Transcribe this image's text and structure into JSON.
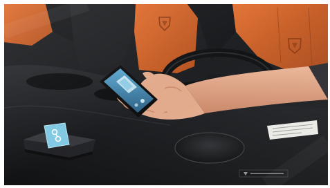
{
  "image": {
    "kind": "photograph",
    "subject_icons": {
      "device_logo": "bluetooth-key-icon",
      "seat_emblem": "shield-emblem-icon"
    },
    "colors": {
      "seat_orange": "#d9652a",
      "seat_black": "#1c1d20",
      "dashboard": "#121315",
      "device_accent": "#7ec8e3",
      "phone_screen": "#3a7fa8",
      "skin": "#e2a98a",
      "sleeve": "#2b2b30"
    }
  }
}
